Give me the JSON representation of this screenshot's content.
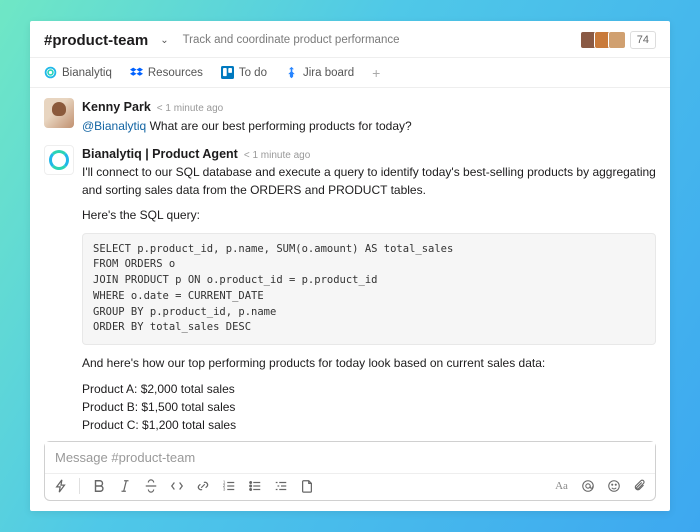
{
  "header": {
    "channel_name": "#product-team",
    "topic": "Track and coordinate product performance",
    "member_count": "74"
  },
  "tabs": {
    "items": [
      {
        "label": "Bianalytiq"
      },
      {
        "label": "Resources"
      },
      {
        "label": "To do"
      },
      {
        "label": "Jira board"
      }
    ]
  },
  "messages": {
    "m0": {
      "author": "Kenny Park",
      "ts": "< 1 minute ago",
      "mention": "@Bianalytiq",
      "text": "What are our best performing products for today?"
    },
    "m1": {
      "author": "Bianalytiq | Product Agent",
      "ts": "< 1 minute ago",
      "intro": "I'll connect to our SQL database and execute a query to identify today's best-selling products by aggregating and sorting sales data from the ORDERS and PRODUCT tables.",
      "sql_label": "Here's the SQL query:",
      "sql": "SELECT p.product_id, p.name, SUM(o.amount) AS total_sales\nFROM ORDERS o\nJOIN PRODUCT p ON o.product_id = p.product_id\nWHERE o.date = CURRENT_DATE\nGROUP BY p.product_id, p.name\nORDER BY total_sales DESC",
      "results_label": "And here's how our top performing products for today look based on current sales data:",
      "results": [
        "Product A: $2,000 total sales",
        "Product B: $1,500 total sales",
        "Product C: $1,200 total sales"
      ]
    }
  },
  "composer": {
    "placeholder": "Message #product-team"
  }
}
